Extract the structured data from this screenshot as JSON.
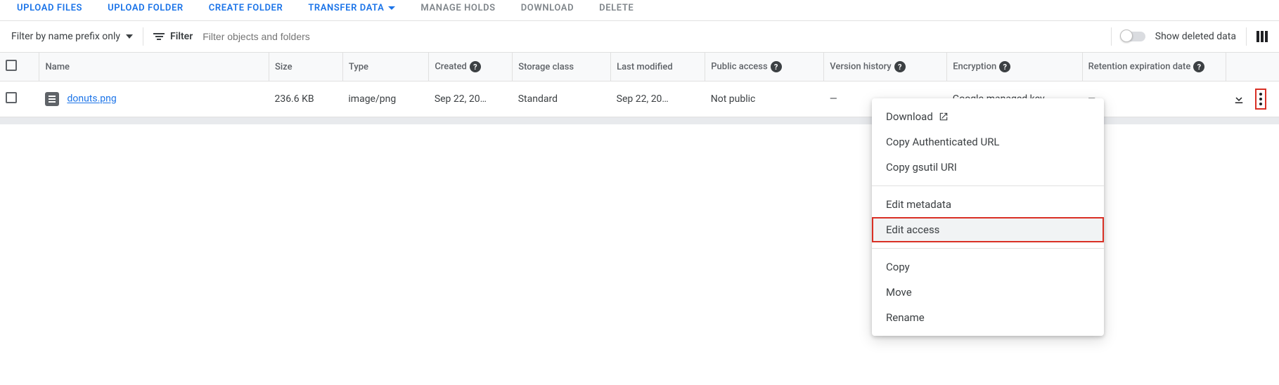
{
  "actions": {
    "upload_files": "UPLOAD FILES",
    "upload_folder": "UPLOAD FOLDER",
    "create_folder": "CREATE FOLDER",
    "transfer_data": "TRANSFER DATA",
    "manage_holds": "MANAGE HOLDS",
    "download": "DOWNLOAD",
    "delete": "DELETE"
  },
  "filter": {
    "mode_label": "Filter by name prefix only",
    "chip_label": "Filter",
    "placeholder": "Filter objects and folders",
    "toggle_label": "Show deleted data"
  },
  "columns": {
    "name": "Name",
    "size": "Size",
    "type": "Type",
    "created": "Created",
    "storage_class": "Storage class",
    "last_modified": "Last modified",
    "public_access": "Public access",
    "version_history": "Version history",
    "encryption": "Encryption",
    "retention_expiration": "Retention expiration date"
  },
  "rows": [
    {
      "name": "donuts.png",
      "size": "236.6 KB",
      "type": "image/png",
      "created": "Sep 22, 20…",
      "storage_class": "Standard",
      "last_modified": "Sep 22, 20…",
      "public_access": "Not public",
      "version_history": "—",
      "encryption": "Google-managed key",
      "retention_expiration": "—"
    }
  ],
  "menu": {
    "download": "Download",
    "copy_auth_url": "Copy Authenticated URL",
    "copy_gsutil": "Copy gsutil URI",
    "edit_metadata": "Edit metadata",
    "edit_access": "Edit access",
    "copy": "Copy",
    "move": "Move",
    "rename": "Rename"
  }
}
